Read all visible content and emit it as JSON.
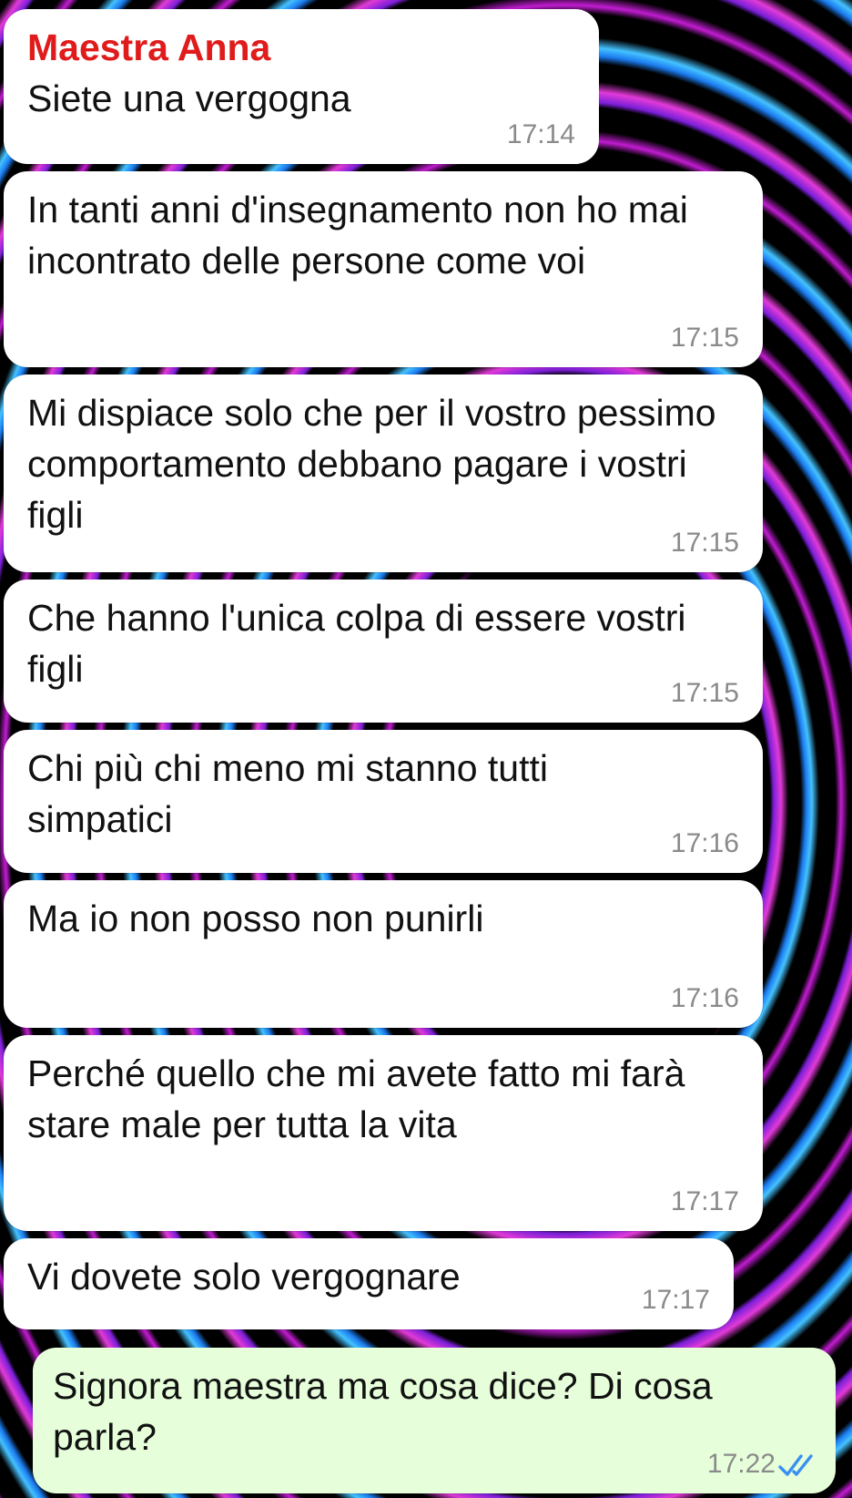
{
  "chat": {
    "contact_name": "Maestra Anna",
    "messages": [
      {
        "text": "Siete una vergogna",
        "time": "17:14",
        "direction": "incoming",
        "show_sender": true
      },
      {
        "text": "In tanti anni d'insegnamento non ho mai incontrato delle persone come voi",
        "time": "17:15",
        "direction": "incoming"
      },
      {
        "text": "Mi dispiace solo che per il vostro pessimo comportamento debbano pagare i vostri figli",
        "time": "17:15",
        "direction": "incoming"
      },
      {
        "text": "Che hanno l'unica colpa di essere vostri figli",
        "time": "17:15",
        "direction": "incoming"
      },
      {
        "text": "Chi più chi meno mi stanno tutti simpatici",
        "time": "17:16",
        "direction": "incoming"
      },
      {
        "text": "Ma io non posso non punirli",
        "time": "17:16",
        "direction": "incoming"
      },
      {
        "text": "Perché quello che mi avete fatto mi farà stare male per tutta la vita",
        "time": "17:17",
        "direction": "incoming"
      },
      {
        "text": "Vi dovete solo vergognare",
        "time": "17:17",
        "direction": "incoming"
      },
      {
        "text": "Signora maestra ma cosa dice? Di cosa parla?",
        "time": "17:22",
        "direction": "outgoing",
        "status_icon": "double-check-read-icon"
      }
    ]
  },
  "colors": {
    "sender_name": "#e01b1b",
    "incoming_bubble": "#ffffff",
    "outgoing_bubble": "#e6ffda",
    "timestamp": "#8a8a8a",
    "read_ticks": "#3a8ff0"
  }
}
